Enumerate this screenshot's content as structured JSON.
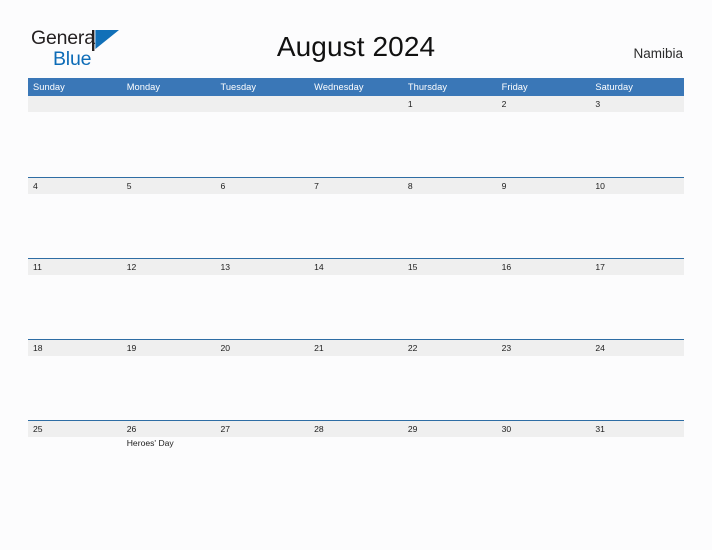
{
  "brand": {
    "name_top": "General",
    "name_bottom": "Blue",
    "flag_icon": "blue-triangle-flag-icon",
    "colors": {
      "top_text": "#231f20",
      "bottom_text": "#0d6cb7",
      "flag": "#1170b8"
    }
  },
  "header": {
    "title": "August 2024",
    "region": "Namibia"
  },
  "theme": {
    "header_blue": "#3a77b7",
    "row_divider_blue": "#2e6da4",
    "band_gray": "#efefef",
    "page_background": "#fcfcfd",
    "text_dark": "#1c1c1c"
  },
  "calendar": {
    "month": "August",
    "year": "2024",
    "weekdays": [
      "Sunday",
      "Monday",
      "Tuesday",
      "Wednesday",
      "Thursday",
      "Friday",
      "Saturday"
    ],
    "weeks": [
      {
        "days": [
          {
            "num": "",
            "event": ""
          },
          {
            "num": "",
            "event": ""
          },
          {
            "num": "",
            "event": ""
          },
          {
            "num": "",
            "event": ""
          },
          {
            "num": "1",
            "event": ""
          },
          {
            "num": "2",
            "event": ""
          },
          {
            "num": "3",
            "event": ""
          }
        ]
      },
      {
        "days": [
          {
            "num": "4",
            "event": ""
          },
          {
            "num": "5",
            "event": ""
          },
          {
            "num": "6",
            "event": ""
          },
          {
            "num": "7",
            "event": ""
          },
          {
            "num": "8",
            "event": ""
          },
          {
            "num": "9",
            "event": ""
          },
          {
            "num": "10",
            "event": ""
          }
        ]
      },
      {
        "days": [
          {
            "num": "11",
            "event": ""
          },
          {
            "num": "12",
            "event": ""
          },
          {
            "num": "13",
            "event": ""
          },
          {
            "num": "14",
            "event": ""
          },
          {
            "num": "15",
            "event": ""
          },
          {
            "num": "16",
            "event": ""
          },
          {
            "num": "17",
            "event": ""
          }
        ]
      },
      {
        "days": [
          {
            "num": "18",
            "event": ""
          },
          {
            "num": "19",
            "event": ""
          },
          {
            "num": "20",
            "event": ""
          },
          {
            "num": "21",
            "event": ""
          },
          {
            "num": "22",
            "event": ""
          },
          {
            "num": "23",
            "event": ""
          },
          {
            "num": "24",
            "event": ""
          }
        ]
      },
      {
        "days": [
          {
            "num": "25",
            "event": ""
          },
          {
            "num": "26",
            "event": "Heroes' Day"
          },
          {
            "num": "27",
            "event": ""
          },
          {
            "num": "28",
            "event": ""
          },
          {
            "num": "29",
            "event": ""
          },
          {
            "num": "30",
            "event": ""
          },
          {
            "num": "31",
            "event": ""
          }
        ]
      }
    ]
  }
}
